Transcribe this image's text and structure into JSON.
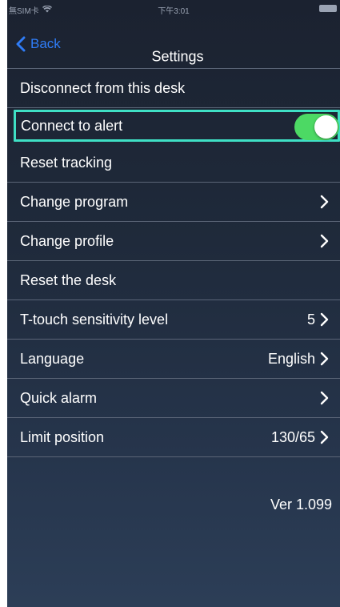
{
  "status_bar": {
    "carrier": "無SIM卡",
    "time": "下午3:01"
  },
  "nav": {
    "back_label": "Back",
    "title": "Settings"
  },
  "rows": [
    {
      "label": "Disconnect from this desk"
    },
    {
      "label": "Connect to alert",
      "toggle": "on"
    },
    {
      "label": "Reset tracking"
    },
    {
      "label": "Change program"
    },
    {
      "label": "Change profile"
    },
    {
      "label": "Reset the desk"
    },
    {
      "label": "T-touch sensitivity level",
      "value": "5"
    },
    {
      "label": "Language",
      "value": "English"
    },
    {
      "label": "Quick alarm"
    },
    {
      "label": "Limit position",
      "value": "130/65"
    }
  ],
  "version": "Ver 1.099",
  "colors": {
    "accent_blue": "#2f7cf6",
    "toggle_on": "#4cd964",
    "highlight": "#3fe0c5",
    "background_top": "#1b2230",
    "background_bottom": "#2c3e57"
  }
}
